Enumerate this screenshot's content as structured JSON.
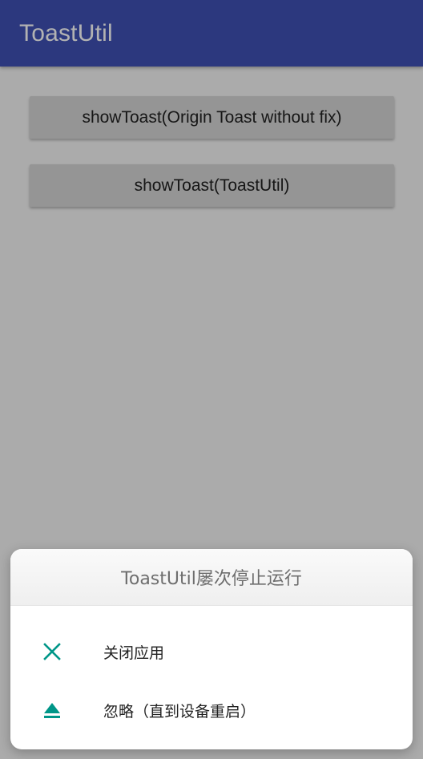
{
  "app_bar": {
    "title": "ToastUtil"
  },
  "buttons": [
    {
      "label": "showToast(Origin Toast without fix)"
    },
    {
      "label": "showToast(ToastUtil)"
    }
  ],
  "crash_dialog": {
    "title": "ToastUtil屡次停止运行",
    "options": [
      {
        "label": "关闭应用",
        "icon": "close-icon"
      },
      {
        "label": "忽略（直到设备重启）",
        "icon": "eject-icon"
      }
    ]
  },
  "colors": {
    "app_bar": "#3f51b5",
    "accent": "#009688",
    "button": "#d6d6d6"
  }
}
